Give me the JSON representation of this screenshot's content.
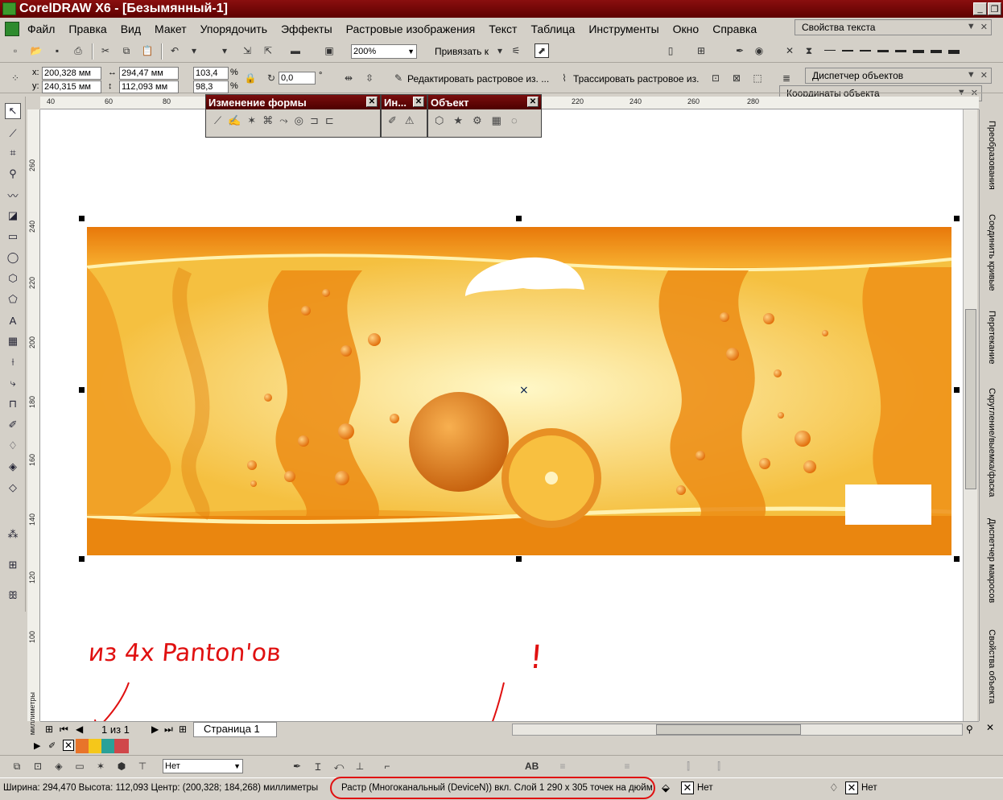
{
  "window": {
    "title": "CorelDRAW X6 - [Безымянный-1]"
  },
  "menu": {
    "items": [
      "Файл",
      "Правка",
      "Вид",
      "Макет",
      "Упорядочить",
      "Эффекты",
      "Растровые изображения",
      "Текст",
      "Таблица",
      "Инструменты",
      "Окно",
      "Справка"
    ]
  },
  "dockers": {
    "text_props": "Свойства текста",
    "object_manager": "Диспетчер объектов",
    "object_coords": "Координаты объекта"
  },
  "toolbar": {
    "zoom": "200%",
    "snap": "Привязать к"
  },
  "property_bar": {
    "x": "200,328 мм",
    "y": "240,315 мм",
    "w": "294,47 мм",
    "h": "112,093 мм",
    "scale_x": "103,4",
    "scale_y": "98,3",
    "pct": "%",
    "rotation": "0,0",
    "deg": "°",
    "edit_bitmap": "Редактировать растровое из. ...",
    "trace_bitmap": "Трассировать растровое из."
  },
  "float_panels": {
    "shape": "Изменение формы",
    "in": "Ин...",
    "object": "Объект"
  },
  "rulers": {
    "h_labels": [
      "40",
      "60",
      "80",
      "220",
      "240",
      "260",
      "280"
    ],
    "v_labels": [
      "260",
      "240",
      "220",
      "200",
      "180",
      "160",
      "140",
      "120",
      "100"
    ],
    "unit": "миллиметры"
  },
  "right_dockers": [
    "Преобразования",
    "Соединить кривые",
    "Перетекание",
    "Скругление/выемка/фаска",
    "Диспетчер макросов",
    "Свойства объекта"
  ],
  "pagenav": {
    "count": "1 из 1",
    "page_tab": "Страница 1"
  },
  "palette": {
    "colors": [
      "#e8742a",
      "#f5c71a",
      "#2aa198",
      "#d0474a"
    ]
  },
  "toolbar3": {
    "outline_select": "Нет",
    "ab_label": "AB"
  },
  "status": {
    "dims": "Ширина: 294,470  Высота: 112,093  Центр: (200,328; 184,268)  миллиметры",
    "object_info": "Растр (Многоканальный (DeviceN)) вкл. Слой 1 290 x 305 точек на дюйм",
    "fill": "Нет",
    "outline": "Нет"
  },
  "annotation": {
    "text": "из 4х Panton'ов",
    "mark": "!"
  },
  "colors": {
    "title_bg": "#6e0505",
    "accent_red": "#e01010",
    "orange": "#f0a020"
  }
}
